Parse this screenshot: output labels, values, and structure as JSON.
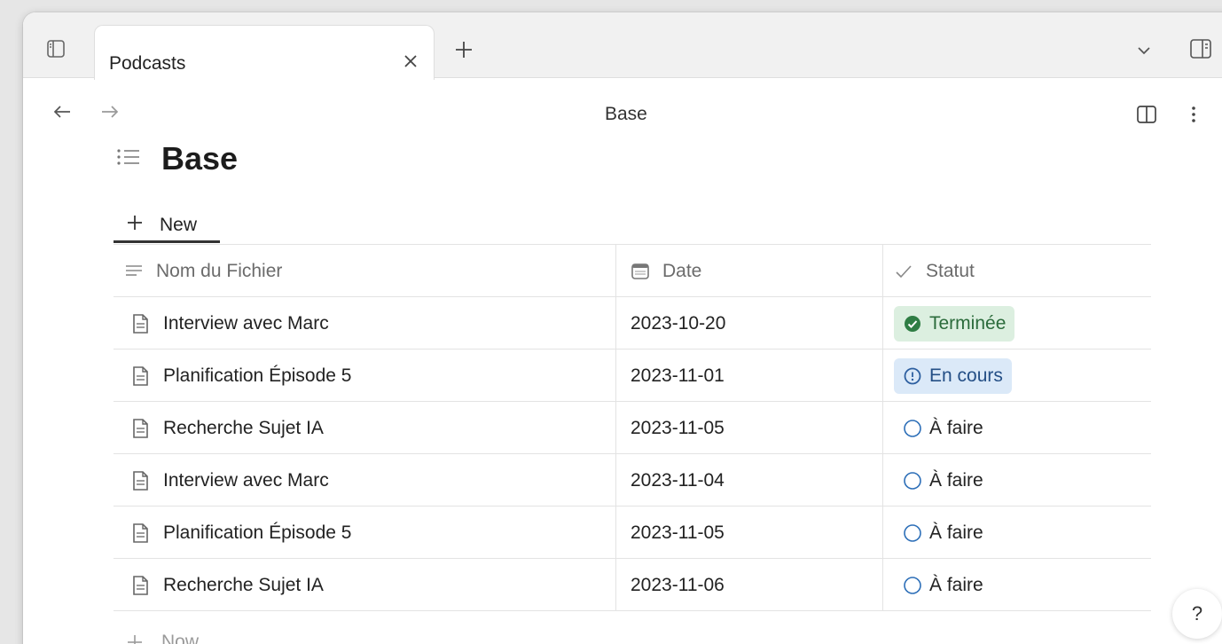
{
  "window": {
    "tab": {
      "label": "Podcasts"
    },
    "nav": {
      "title": "Base"
    }
  },
  "page": {
    "title": "Base",
    "view_tab_label": "New",
    "columns": {
      "name": "Nom du Fichier",
      "date": "Date",
      "status": "Statut"
    },
    "rows": [
      {
        "name": "Interview avec Marc",
        "date": "2023-10-20",
        "status": "Terminée",
        "status_type": "done"
      },
      {
        "name": "Planification Épisode 5",
        "date": "2023-11-01",
        "status": "En cours",
        "status_type": "progress"
      },
      {
        "name": "Recherche Sujet IA",
        "date": "2023-11-05",
        "status": "À faire",
        "status_type": "todo"
      },
      {
        "name": "Interview avec Marc",
        "date": "2023-11-04",
        "status": "À faire",
        "status_type": "todo"
      },
      {
        "name": "Planification Épisode 5",
        "date": "2023-11-05",
        "status": "À faire",
        "status_type": "todo"
      },
      {
        "name": "Recherche Sujet IA",
        "date": "2023-11-06",
        "status": "À faire",
        "status_type": "todo"
      }
    ],
    "add_row_label": "Now"
  },
  "help": {
    "label": "?"
  },
  "colors": {
    "done_bg": "#dcefe0",
    "done_fg": "#2b6b3b",
    "progress_bg": "#dbe9f8",
    "progress_fg": "#244f86",
    "accent": "#333333"
  },
  "icons": {
    "sidebar_toggle": "sidebar-toggle-icon",
    "tab_close": "close-icon",
    "new_tab": "plus-icon",
    "tab_list": "chevron-down-icon",
    "right_sidebar": "right-sidebar-icon",
    "back": "arrow-left-icon",
    "forward": "arrow-right-icon",
    "reading_view": "split-view-icon",
    "more": "more-vertical-icon",
    "page": "list-icon",
    "column_name": "text-lines-icon",
    "column_date": "calendar-icon",
    "column_status": "check-icon",
    "file": "file-icon",
    "done": "check-circle-icon",
    "progress": "progress-circle-icon",
    "todo": "empty-circle-icon"
  }
}
